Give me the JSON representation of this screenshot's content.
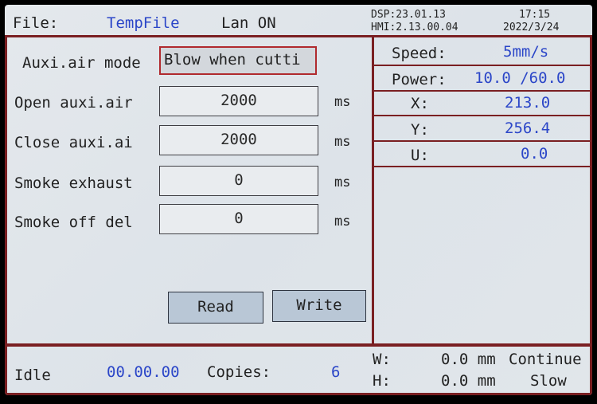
{
  "header": {
    "file_label": "File:",
    "file_name": "TempFile",
    "lan_status": "Lan ON",
    "dsp_version": "DSP:23.01.13",
    "hmi_version": "HMI:2.13.00.04",
    "time": "17:15",
    "date": "2022/3/24"
  },
  "settings": {
    "mode_label": "Auxi.air mode",
    "mode_value": "Blow when cutti",
    "rows": [
      {
        "label": "Open auxi.air",
        "value": "2000",
        "unit": "ms"
      },
      {
        "label": "Close auxi.ai",
        "value": "2000",
        "unit": "ms"
      },
      {
        "label": "Smoke exhaust",
        "value": "0",
        "unit": "ms"
      },
      {
        "label": "Smoke off del",
        "value": "0",
        "unit": "ms"
      }
    ],
    "read_label": "Read",
    "write_label": "Write"
  },
  "status_panel": {
    "speed_label": "Speed:",
    "speed_value": "5mm/s",
    "power_label": "Power:",
    "power_value": "10.0 /60.0",
    "x_label": "X:",
    "x_value": "213.0",
    "y_label": "Y:",
    "y_value": "256.4",
    "u_label": "U:",
    "u_value": "0.0"
  },
  "footer": {
    "state": "Idle",
    "elapsed": "00.00.00",
    "copies_label": "Copies:",
    "copies_value": "6",
    "w_label": "W:",
    "w_value": "0.0 mm",
    "h_label": "H:",
    "h_value": "0.0 mm",
    "mode_continue": "Continue",
    "mode_slow": "Slow"
  },
  "colors": {
    "frame": "#7a1f22",
    "value_blue": "#2b46c8",
    "button_fill": "#b9c7d6",
    "highlight_border": "#b02a2e"
  }
}
